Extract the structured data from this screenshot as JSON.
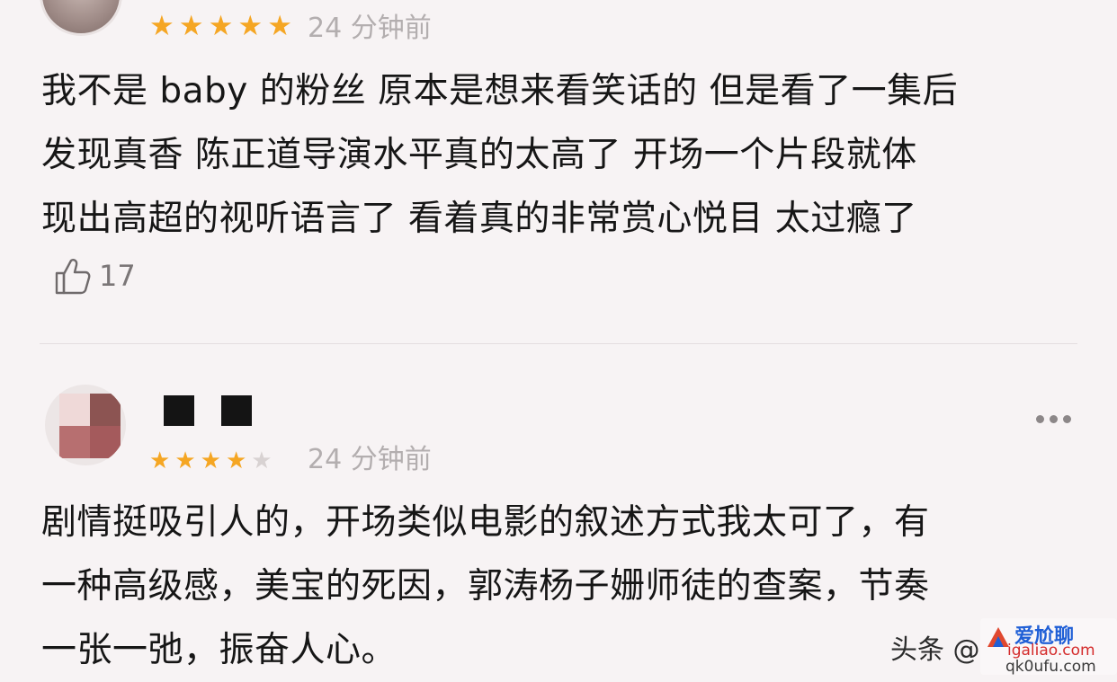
{
  "comment1": {
    "time": "24 分钟前",
    "rating": 5,
    "lines": [
      "我不是 baby 的粉丝 原本是想来看笑话的 但是看了一集后",
      "发现真香 陈正道导演水平真的太高了 开场一个片段就体",
      "现出高超的视听语言了 看着真的非常赏心悦目 太过瘾了"
    ],
    "likes": "17"
  },
  "comment2": {
    "time": "24 分钟前",
    "rating": 4,
    "lines": [
      "剧情挺吸引人的，开场类似电影的叙述方式我太可了，有",
      "一种高级感，美宝的死因，郭涛杨子姗师徒的查案，节奏",
      "一张一弛，振奋人心。"
    ]
  },
  "watermark": {
    "text": "头条 @",
    "logo_line1": "爱尬聊",
    "logo_line2": "igaliao.com",
    "logo_line3": "qk0ufu.com"
  },
  "colors": {
    "star": "#f5a623",
    "background": "#f7f3f4"
  }
}
